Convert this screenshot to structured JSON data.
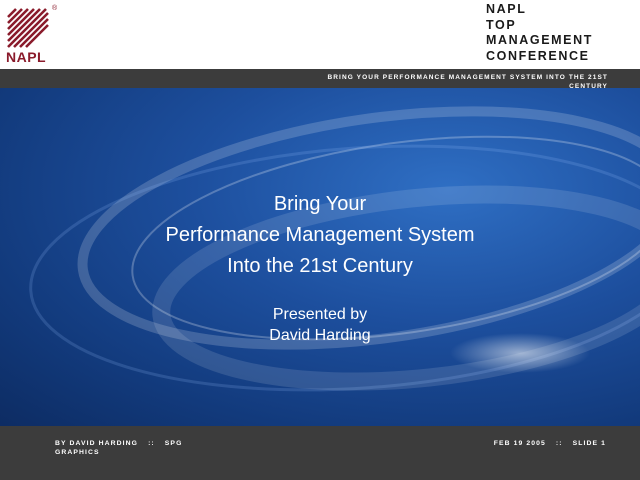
{
  "logo": {
    "text": "NAPL",
    "registered": "®",
    "brand_color": "#8a1b2b"
  },
  "conference": {
    "lines": [
      "NAPL",
      "TOP",
      "MANAGEMENT",
      "CONFERENCE"
    ]
  },
  "tagline": "BRING YOUR PERFORMANCE MANAGEMENT SYSTEM INTO THE 21ST CENTURY",
  "slide": {
    "title_lines": [
      "Bring Your",
      "Performance Management System",
      "Into the 21st Century"
    ],
    "presenter_lines": [
      "Presented by",
      "David Harding"
    ]
  },
  "footer": {
    "author": "BY  DAVID HARDING",
    "separator": "::",
    "company": "SPG GRAPHICS",
    "date": "FEB 19 2005",
    "slide_number": "SLIDE 1"
  },
  "colors": {
    "bar": "#3c3c3c",
    "background": "#1d4f9e",
    "text": "#ffffff"
  }
}
